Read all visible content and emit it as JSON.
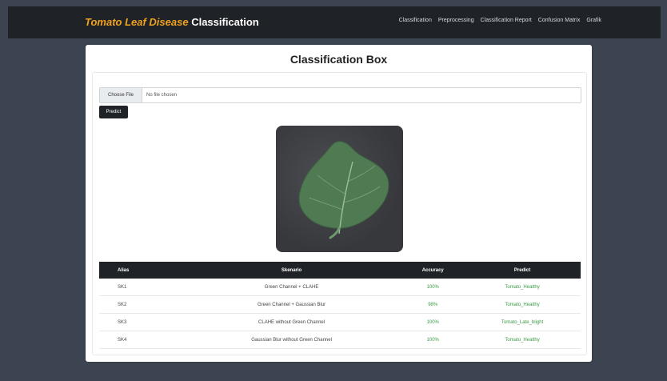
{
  "navbar": {
    "brand_accent": "Tomato Leaf Disease",
    "brand_rest": "Classification",
    "links": [
      "Classification",
      "Preprocessing",
      "Classification Report",
      "Confusion Matrix",
      "Grafik"
    ]
  },
  "card": {
    "title": "Classification Box",
    "file": {
      "choose_label": "Choose File",
      "file_name": "No file chosen"
    },
    "predict_label": "Predict",
    "image": {
      "icon": "tomato-leaf-icon",
      "alt": ""
    },
    "table": {
      "headers": [
        "Alias",
        "Skenario",
        "Accuracy",
        "Predict"
      ],
      "rows": [
        {
          "alias": "SK1",
          "skenario": "Green Channel + CLAHE",
          "accuracy": "100%",
          "predict": "Tomato_Healthy"
        },
        {
          "alias": "SK2",
          "skenario": "Green Channel + Gaussian Blur",
          "accuracy": "98%",
          "predict": "Tomato_Healthy"
        },
        {
          "alias": "SK3",
          "skenario": "CLAHE without Green Channel",
          "accuracy": "100%",
          "predict": "Tomato_Late_blight"
        },
        {
          "alias": "SK4",
          "skenario": "Gaussian Blur without Green Channel",
          "accuracy": "100%",
          "predict": "Tomato_Healthy"
        }
      ]
    }
  },
  "colors": {
    "navbar": "#1f2327",
    "brand_accent": "#f0a21f",
    "page_bg": "#3b4450",
    "accuracy_green": "#3a9a46"
  }
}
